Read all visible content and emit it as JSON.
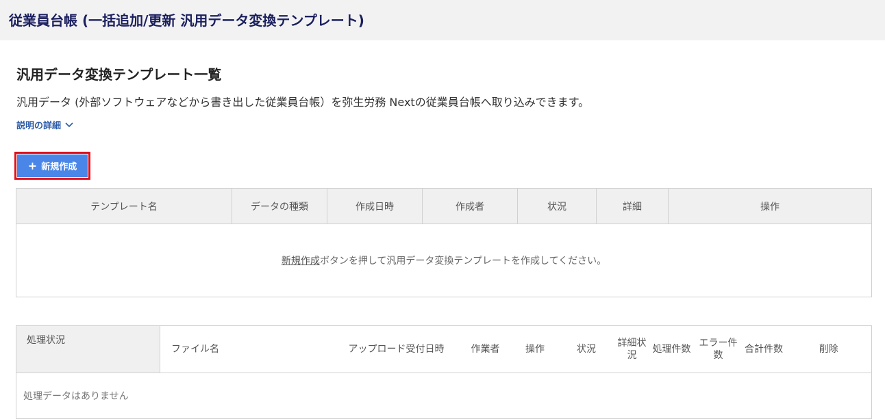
{
  "header": {
    "title": "従業員台帳 (一括追加/更新 汎用データ変換テンプレート)"
  },
  "section": {
    "title": "汎用データ変換テンプレート一覧",
    "description": "汎用データ (外部ソフトウェアなどから書き出した従業員台帳）を弥生労務 Nextの従業員台帳へ取り込みできます。",
    "details_label": "説明の詳細"
  },
  "new_button": {
    "label": "新規作成",
    "icon": "plus-icon"
  },
  "template_table": {
    "columns": [
      "テンプレート名",
      "データの種類",
      "作成日時",
      "作成者",
      "状況",
      "詳細",
      "操作"
    ],
    "empty_link": "新規作成",
    "empty_text": "ボタンを押して汎用データ変換テンプレートを作成してください。"
  },
  "processing_table": {
    "columns": [
      "処理状況",
      "ファイル名",
      "アップロード受付日時",
      "作業者",
      "操作",
      "状況",
      "詳細状況",
      "処理件数",
      "エラー件数",
      "合計件数",
      "削除"
    ],
    "empty_text": "処理データはありません"
  },
  "colors": {
    "accent": "#4a86e8",
    "header_text": "#1a1f5e",
    "highlight": "#e0101a",
    "link": "#2a5aa8"
  }
}
